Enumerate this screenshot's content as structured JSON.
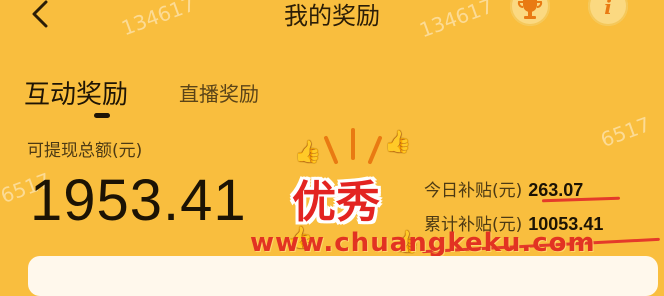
{
  "header": {
    "title": "我的奖励",
    "back_icon": "chevron-left-icon",
    "trophy_icon": "trophy-icon",
    "info_icon": "info-icon",
    "info_glyph": "i"
  },
  "tabs": [
    {
      "label": "互动奖励",
      "active": true
    },
    {
      "label": "直播奖励",
      "active": false
    }
  ],
  "balance": {
    "label": "可提现总额(元)",
    "amount": "1953.41"
  },
  "stats": {
    "today_label": "今日补贴(元)",
    "today_value": "263.07",
    "total_label": "累计补贴(元)",
    "total_value": "10053.41"
  },
  "overlay": {
    "sticker_text": "优秀",
    "watermark_text": "www.chuangkeku.com",
    "wm_numbers": [
      "134617",
      "134617",
      "6517",
      "6517"
    ]
  },
  "colors": {
    "background": "#F9BE3E",
    "accent_red": "#E32421",
    "thumb_yellow": "#F6C515"
  }
}
